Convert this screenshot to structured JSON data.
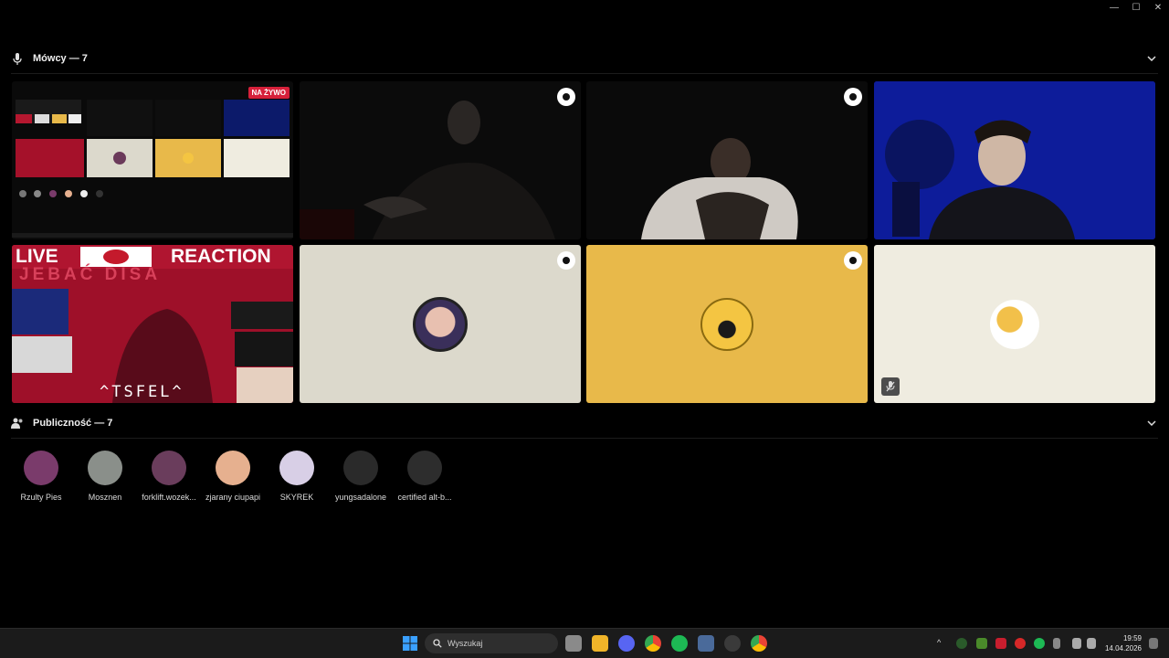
{
  "speakers": {
    "title": "Mówcy — 7"
  },
  "audience": {
    "title": "Publiczność — 7",
    "members": [
      {
        "name": "Rzulty Pies",
        "color": "#7a3b6b"
      },
      {
        "name": "Mosznen",
        "color": "#8a8f8a"
      },
      {
        "name": "forklift.wozek...",
        "color": "#6a3d5c"
      },
      {
        "name": "zjarany ciupapi",
        "color": "#e6b08f"
      },
      {
        "name": "SKYREK",
        "color": "#d8cfe6"
      },
      {
        "name": "yungsadalone",
        "color": "#2a2a2a"
      },
      {
        "name": "certified alt-b...",
        "color": "#2d2d2d"
      }
    ]
  },
  "stream": {
    "live_label": "NA ŻYWO"
  },
  "screen": {
    "line1_left": "LIVE",
    "line1_right": "REACTION",
    "banner": "JEBAĆ DISA",
    "signature": "^TSFEL^"
  },
  "taskbar": {
    "search_placeholder": "Wyszukaj",
    "time": "19:59",
    "date": "14.04.2026"
  },
  "colors": {
    "accent_live": "#d6203a",
    "yellow_tile": "#e8b94a",
    "cream_tile": "#dcd9cc",
    "light_tile": "#efece0"
  }
}
